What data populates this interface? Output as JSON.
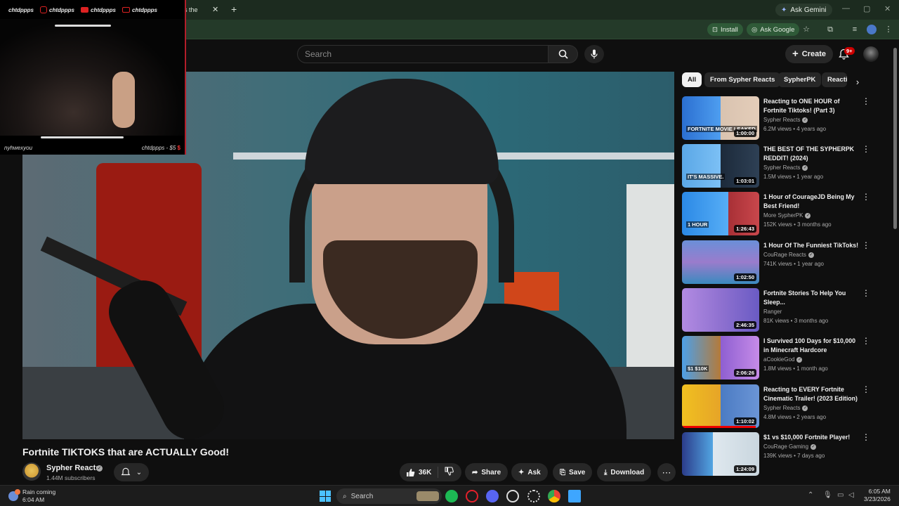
{
  "browser": {
    "tab_title": "s the",
    "ask_gemini": "Ask Gemini",
    "install": "Install",
    "ask_google": "Ask Google"
  },
  "overlay": {
    "top_items": [
      "chtdppps",
      "chtdppps",
      "chtdppps",
      "chtdppps"
    ],
    "bottom_left": "nyhwexyou",
    "bottom_right": "chtdppps - $5",
    "accent": "#b21e2a"
  },
  "youtube": {
    "search_placeholder": "Search",
    "create": "Create",
    "notifications": "9+",
    "video_title": "Fortnite TIKTOKS that are ACTUALLY Good!",
    "channel": "Sypher Reacts",
    "subscribers": "1.44M subscribers",
    "likes": "36K",
    "share": "Share",
    "ask": "Ask",
    "save": "Save",
    "download": "Download",
    "chips": [
      "All",
      "From Sypher Reacts",
      "SypherPK",
      "Reacti"
    ],
    "recommendations": [
      {
        "title": "Reacting to ONE HOUR of Fortnite Tiktoks! (Part 3)",
        "channel": "Sypher Reacts",
        "verified": true,
        "meta": "6.2M views • 4 years ago",
        "duration": "1:00:00",
        "thumb_text": "FORTNITE MOVIE LEAKED",
        "watched": 0
      },
      {
        "title": "THE BEST OF THE SYPHERPK REDDIT! (2024)",
        "channel": "Sypher Reacts",
        "verified": true,
        "meta": "1.5M views • 1 year ago",
        "duration": "1:03:01",
        "thumb_text": "IT'S MASSIVE.",
        "watched": 0
      },
      {
        "title": "1 Hour of CourageJD Being My Best Friend!",
        "channel": "More SypherPK",
        "verified": true,
        "meta": "152K views • 3 months ago",
        "duration": "1:26:43",
        "thumb_text": "1 HOUR",
        "watched": 0
      },
      {
        "title": "1 Hour Of The Funniest TikToks!",
        "channel": "CouRage Reacts",
        "verified": true,
        "meta": "741K views • 1 year ago",
        "duration": "1:02:50",
        "thumb_text": "",
        "watched": 0
      },
      {
        "title": "Fortnite Stories To Help You Sleep...",
        "channel": "Ranger",
        "verified": false,
        "meta": "81K views • 3 months ago",
        "duration": "2:46:35",
        "thumb_text": "",
        "watched": 0
      },
      {
        "title": "I Survived 100 Days for $10,000 in Minecraft Hardcore",
        "channel": "aCookieGod",
        "verified": true,
        "meta": "1.8M views • 1 month ago",
        "duration": "2:06:26",
        "thumb_text": "$1   $10K",
        "watched": 0
      },
      {
        "title": "Reacting to EVERY Fortnite Cinematic Trailer! (2023 Edition)",
        "channel": "Sypher Reacts",
        "verified": true,
        "meta": "4.8M views • 2 years ago",
        "duration": "1:10:02",
        "thumb_text": "",
        "watched": 0.95
      },
      {
        "title": "$1 vs $10,000 Fortnite Player!",
        "channel": "CouRage Gaming",
        "verified": true,
        "meta": "139K views • 7 days ago",
        "duration": "1:24:09",
        "thumb_text": "",
        "watched": 0
      }
    ]
  },
  "taskbar": {
    "weather_title": "Rain coming",
    "weather_time": "6:04 AM",
    "search": "Search",
    "time": "6:05 AM",
    "date": "3/23/2026"
  }
}
